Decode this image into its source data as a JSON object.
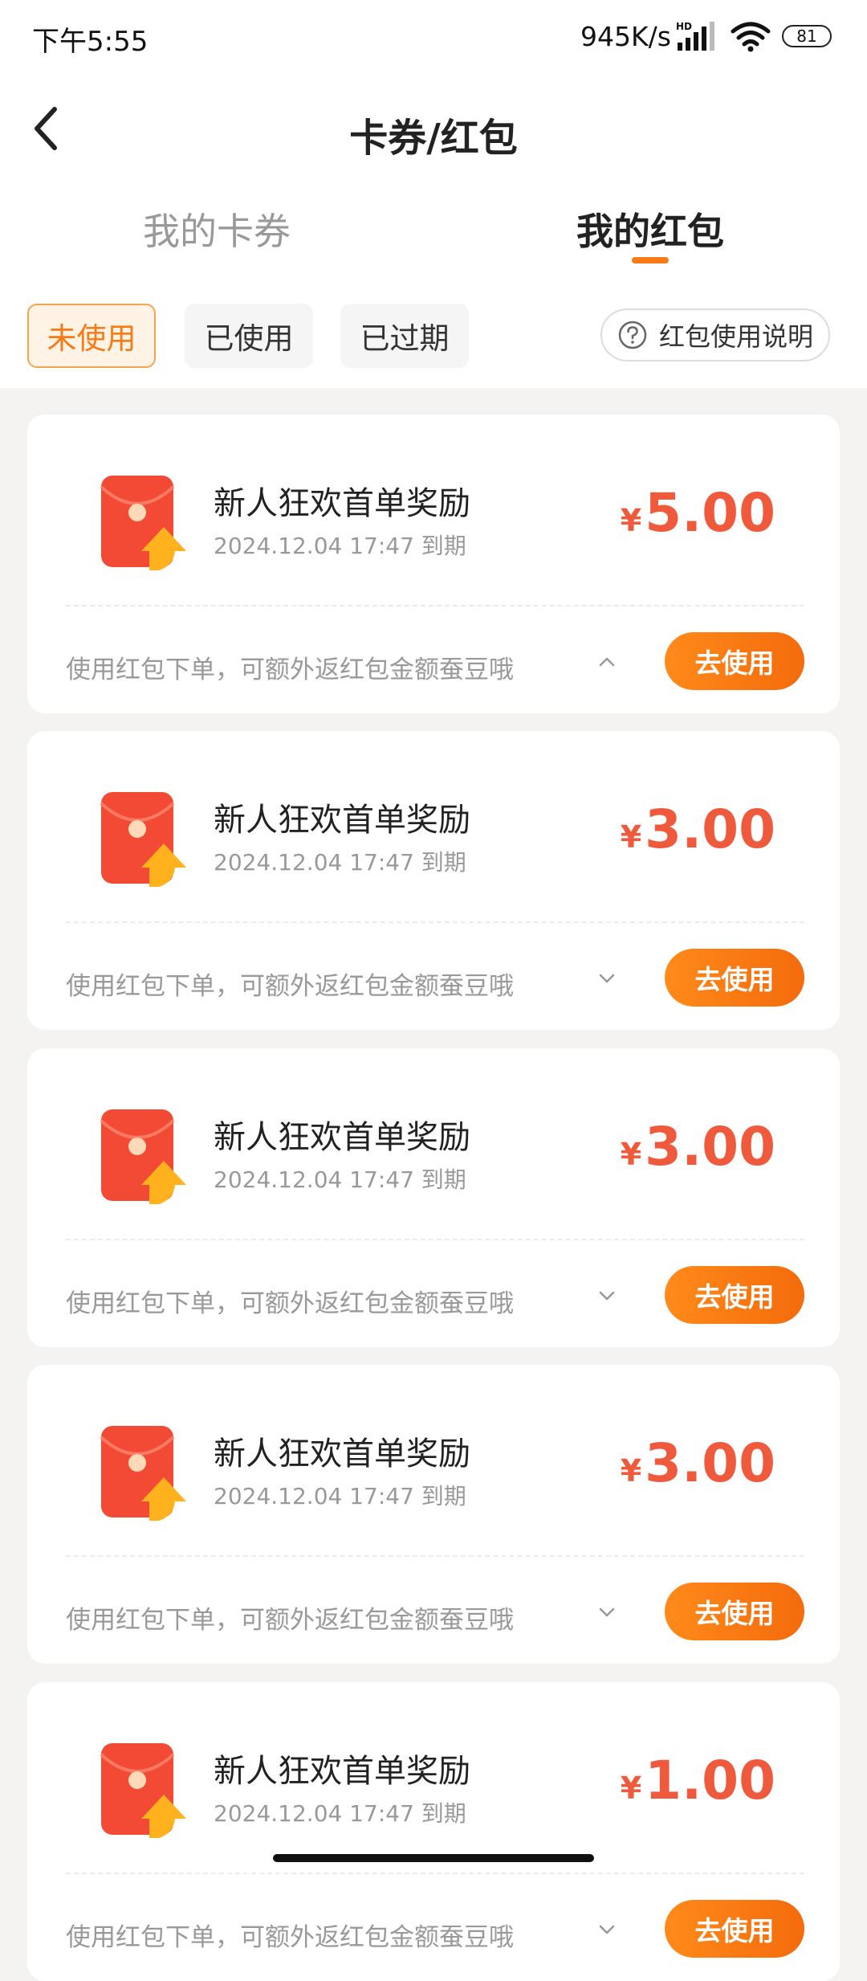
{
  "status_bar": {
    "time": "下午5:55",
    "network_speed": "945K/s",
    "signal_badge": "HD",
    "battery": "81"
  },
  "header": {
    "title": "卡券/红包"
  },
  "main_tabs": [
    {
      "label": "我的卡券",
      "active": false
    },
    {
      "label": "我的红包",
      "active": true
    }
  ],
  "filters": [
    {
      "label": "未使用",
      "active": true
    },
    {
      "label": "已使用",
      "active": false
    },
    {
      "label": "已过期",
      "active": false
    }
  ],
  "help_button": {
    "label": "红包使用说明",
    "icon": "question-circle-icon"
  },
  "colors": {
    "accent": "#f77a14",
    "amount": "#ef5a3c",
    "background": "#f4f3f2"
  },
  "cards": [
    {
      "title": "新人狂欢首单奖励",
      "expiry": "2024.12.04 17:47 到期",
      "currency": "¥",
      "amount": "5.00",
      "description": "使用红包下单，可额外返红包金额蚕豆哦",
      "expanded": true,
      "button": "去使用"
    },
    {
      "title": "新人狂欢首单奖励",
      "expiry": "2024.12.04 17:47 到期",
      "currency": "¥",
      "amount": "3.00",
      "description": "使用红包下单，可额外返红包金额蚕豆哦",
      "expanded": false,
      "button": "去使用"
    },
    {
      "title": "新人狂欢首单奖励",
      "expiry": "2024.12.04 17:47 到期",
      "currency": "¥",
      "amount": "3.00",
      "description": "使用红包下单，可额外返红包金额蚕豆哦",
      "expanded": false,
      "button": "去使用"
    },
    {
      "title": "新人狂欢首单奖励",
      "expiry": "2024.12.04 17:47 到期",
      "currency": "¥",
      "amount": "3.00",
      "description": "使用红包下单，可额外返红包金额蚕豆哦",
      "expanded": false,
      "button": "去使用"
    },
    {
      "title": "新人狂欢首单奖励",
      "expiry": "2024.12.04 17:47 到期",
      "currency": "¥",
      "amount": "1.00",
      "description": "使用红包下单，可额外返红包金额蚕豆哦",
      "expanded": false,
      "button": "去使用"
    }
  ]
}
